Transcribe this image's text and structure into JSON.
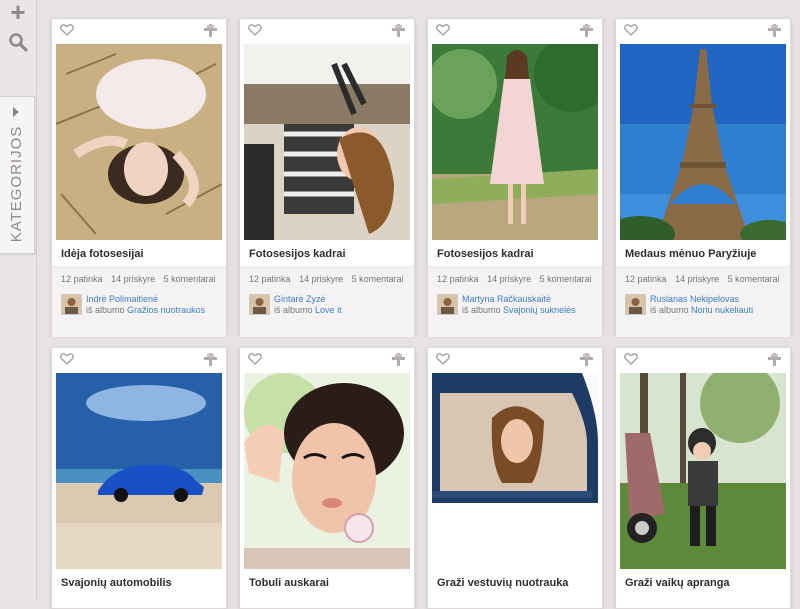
{
  "sidebar": {
    "add_icon": "plus-icon",
    "search_icon": "search-icon",
    "categories_label": "KATEGORIJOS"
  },
  "colors": {
    "link": "#3c7fc4",
    "background": "#e6e2e1",
    "card": "#ffffff"
  },
  "cards": [
    {
      "title": "Idėja fotosesijai",
      "likes": "12 patinka",
      "pins": "14 priskyre",
      "comments": "5 komentarai",
      "author": "Indrė Polimaitienė",
      "album_prefix": "iš albumo",
      "album": "Gražios nuotraukos",
      "photo": "woman-lying-on-hay"
    },
    {
      "title": "Fotosesijos kadrai",
      "likes": "12 patinka",
      "pins": "14 priskyre",
      "comments": "5 komentarai",
      "author": "Gintarė Zyzė",
      "album_prefix": "iš albumo",
      "album": "Love it",
      "photo": "woman-in-car-seat"
    },
    {
      "title": "Fotosesijos kadrai",
      "likes": "12 patinka",
      "pins": "14 priskyre",
      "comments": "5 komentarai",
      "author": "Martyna Račkauskaitė",
      "album_prefix": "iš albumo",
      "album": "Svajonių suknelės",
      "photo": "woman-in-pink-dress"
    },
    {
      "title": "Medaus mėnuo Paryžiuje",
      "likes": "12 patinka",
      "pins": "14 priskyre",
      "comments": "5 komentarai",
      "author": "Ruslanas Nekipelovas",
      "album_prefix": "iš albumo",
      "album": "Noriu nukeliauti",
      "photo": "eiffel-tower"
    },
    {
      "title": "Svajonių automobilis",
      "photo": "blue-sports-car"
    },
    {
      "title": "Tobuli auskarai",
      "photo": "woman-with-earrings"
    },
    {
      "title": "Graži vestuvių nuotrauka",
      "photo": "bride-in-car-window"
    },
    {
      "title": "Graži vaikų apranga",
      "photo": "child-with-scooter"
    }
  ]
}
